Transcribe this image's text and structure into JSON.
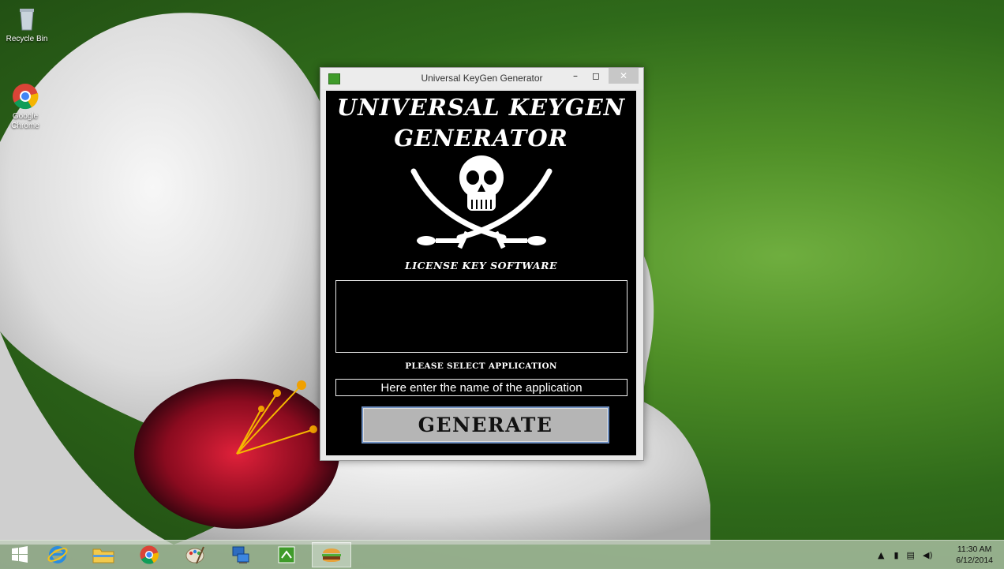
{
  "desktop": {
    "icons": [
      {
        "label": "Recycle Bin",
        "icon": "recycle-bin-icon"
      },
      {
        "label": "Google Chrome",
        "icon": "chrome-icon"
      }
    ]
  },
  "window": {
    "title": "Universal KeyGen Generator",
    "minimize_glyph": "–",
    "maximize_glyph": "◻",
    "close_glyph": "✕",
    "heading_line1": "UNIVERSAL KEYGEN",
    "heading_line2": "GENERATOR",
    "logo_icon": "pirate-skull-crossed-swords-icon",
    "subtitle": "LICENSE KEY SOFTWARE",
    "output_value": "",
    "select_label": "PLEASE SELECT APPLICATION",
    "app_input_value": "Here enter the name of the application",
    "generate_label": "GENERATE"
  },
  "taskbar": {
    "items": [
      {
        "name": "start",
        "icon": "windows-logo-icon"
      },
      {
        "name": "internet-explorer",
        "icon": "internet-explorer-icon"
      },
      {
        "name": "file-explorer",
        "icon": "folder-icon"
      },
      {
        "name": "chrome",
        "icon": "chrome-icon"
      },
      {
        "name": "paint",
        "icon": "paint-icon"
      },
      {
        "name": "remote-desktop",
        "icon": "computer-network-icon"
      },
      {
        "name": "keygen-app",
        "icon": "keygen-app-icon"
      },
      {
        "name": "active-app",
        "icon": "burger-icon",
        "active": true
      }
    ],
    "tray_icons": [
      "up-arrow-icon",
      "battery-icon",
      "network-icon",
      "volume-icon"
    ],
    "time": "11:30 AM",
    "date": "6/12/2014"
  },
  "colors": {
    "window_bg": "#000000",
    "text": "#ffffff",
    "button_face": "#b5b5b5",
    "button_border": "#6f8fc0"
  }
}
